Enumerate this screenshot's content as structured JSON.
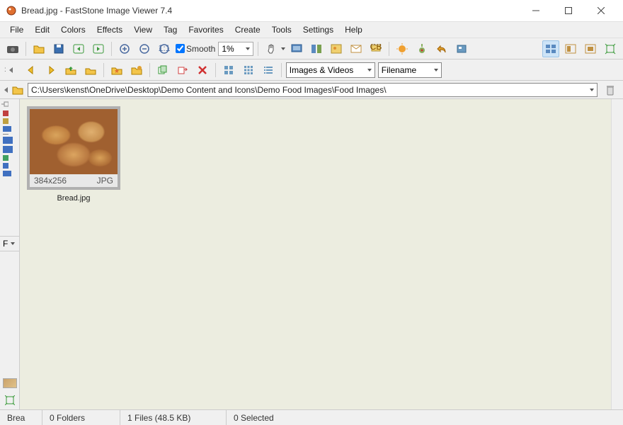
{
  "title": "Bread.jpg  -  FastStone Image Viewer 7.4",
  "menus": [
    "File",
    "Edit",
    "Colors",
    "Effects",
    "View",
    "Tag",
    "Favorites",
    "Create",
    "Tools",
    "Settings",
    "Help"
  ],
  "toolbar1": {
    "smooth_label": "Smooth",
    "smooth_checked": true,
    "zoom_value": "1%"
  },
  "toolbar2": {
    "filter_label": "Images & Videos",
    "sort_label": "Filename"
  },
  "path": "C:\\Users\\kenst\\OneDrive\\Desktop\\Demo Content and Icons\\Demo Food Images\\Food Images\\",
  "left_panel": {
    "handle_label": ":",
    "folder_f": "F",
    "drop_tri": "▾"
  },
  "thumb": {
    "dims": "384x256",
    "format": "JPG",
    "name": "Bread.jpg"
  },
  "status": {
    "file": "Brea",
    "folders": "0 Folders",
    "files": "1 Files (48.5 KB)",
    "selected": "0 Selected"
  }
}
